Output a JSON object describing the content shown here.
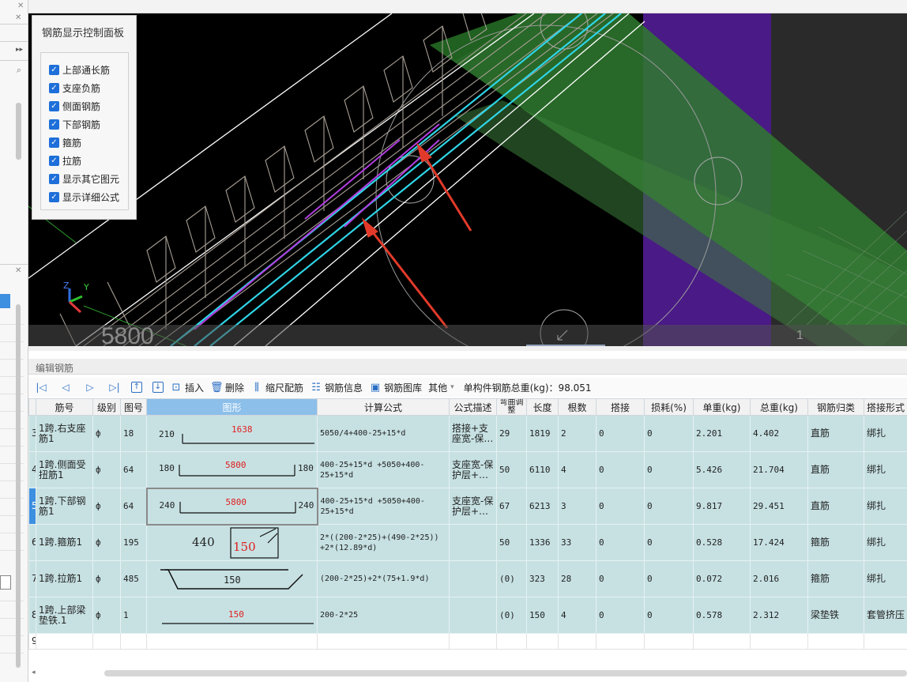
{
  "control_panel": {
    "title": "钢筋显示控制面板",
    "items": [
      {
        "label": "上部通长筋",
        "checked": true
      },
      {
        "label": "支座负筋",
        "checked": true
      },
      {
        "label": "侧面钢筋",
        "checked": true
      },
      {
        "label": "下部钢筋",
        "checked": true
      },
      {
        "label": "箍筋",
        "checked": true
      },
      {
        "label": "拉筋",
        "checked": true
      },
      {
        "label": "显示其它图元",
        "checked": true
      },
      {
        "label": "显示详细公式",
        "checked": true
      }
    ]
  },
  "viewport": {
    "dimension_label": "5800",
    "page_number": "1",
    "axis_labels": {
      "z": "Z",
      "y": "Y"
    }
  },
  "editor": {
    "title": "编辑钢筋",
    "toolbar": {
      "insert": "插入",
      "delete": "删除",
      "scale_rebar": "缩尺配筋",
      "rebar_info": "钢筋信息",
      "rebar_library": "钢筋图库",
      "other": "其他",
      "total_weight": "单构件钢筋总重(kg)：98.051"
    },
    "columns": [
      "筋号",
      "级别",
      "图号",
      "图形",
      "计算公式",
      "公式描述",
      "弯曲调整",
      "长度",
      "根数",
      "搭接",
      "损耗(%)",
      "单重(kg)",
      "总重(kg)",
      "钢筋归类",
      "搭接形式"
    ],
    "rows": [
      {
        "no": "3",
        "name": "1跨.右支座筋1",
        "grade": "ф",
        "fig": "18",
        "shape_left": "210",
        "shape_mid": "1638",
        "shape_right": "",
        "formula": "5050/4+400-25+15*d",
        "desc": "搭接+支座宽-保…",
        "bend": "29",
        "length": "1819",
        "count": "2",
        "lap": "0",
        "loss": "0",
        "unit_w": "2.201",
        "total_w": "4.402",
        "class": "直筋",
        "lap_type": "绑扎"
      },
      {
        "no": "4",
        "name": "1跨.侧面受扭筋1",
        "grade": "ф",
        "fig": "64",
        "shape_left": "180",
        "shape_mid": "5800",
        "shape_right": "180",
        "formula": "400-25+15*d +5050+400-25+15*d",
        "desc": "支座宽-保护层+…",
        "bend": "50",
        "length": "6110",
        "count": "4",
        "lap": "0",
        "loss": "0",
        "unit_w": "5.426",
        "total_w": "21.704",
        "class": "直筋",
        "lap_type": "绑扎"
      },
      {
        "no": "5",
        "name": "1跨.下部钢筋1",
        "grade": "ф",
        "fig": "64",
        "shape_left": "240",
        "shape_mid": "5800",
        "shape_right": "240",
        "formula": "400-25+15*d +5050+400-25+15*d",
        "desc": "支座宽-保护层+…",
        "bend": "67",
        "length": "6213",
        "count": "3",
        "lap": "0",
        "loss": "0",
        "unit_w": "9.817",
        "total_w": "29.451",
        "class": "直筋",
        "lap_type": "绑扎"
      },
      {
        "no": "6",
        "name": "1跨.箍筋1",
        "grade": "ф",
        "fig": "195",
        "shape_left": "440",
        "shape_mid": "150",
        "shape_right": "",
        "formula": "2*((200-2*25)+(490-2*25)) +2*(12.89*d)",
        "desc": "",
        "bend": "50",
        "length": "1336",
        "count": "33",
        "lap": "0",
        "loss": "0",
        "unit_w": "0.528",
        "total_w": "17.424",
        "class": "箍筋",
        "lap_type": "绑扎"
      },
      {
        "no": "7",
        "name": "1跨.拉筋1",
        "grade": "ф",
        "fig": "485",
        "shape_left": "",
        "shape_mid": "150",
        "shape_right": "",
        "formula": "(200-2*25)+2*(75+1.9*d)",
        "desc": "",
        "bend": "(0)",
        "length": "323",
        "count": "28",
        "lap": "0",
        "loss": "0",
        "unit_w": "0.072",
        "total_w": "2.016",
        "class": "箍筋",
        "lap_type": "绑扎"
      },
      {
        "no": "8",
        "name": "1跨.上部梁垫铁.1",
        "grade": "ф",
        "fig": "1",
        "shape_left": "",
        "shape_mid": "150",
        "shape_right": "",
        "formula": "200-2*25",
        "desc": "",
        "bend": "(0)",
        "length": "150",
        "count": "4",
        "lap": "0",
        "loss": "0",
        "unit_w": "0.578",
        "total_w": "2.312",
        "class": "梁垫铁",
        "lap_type": "套管挤压"
      }
    ],
    "empty_row_no": "9"
  }
}
